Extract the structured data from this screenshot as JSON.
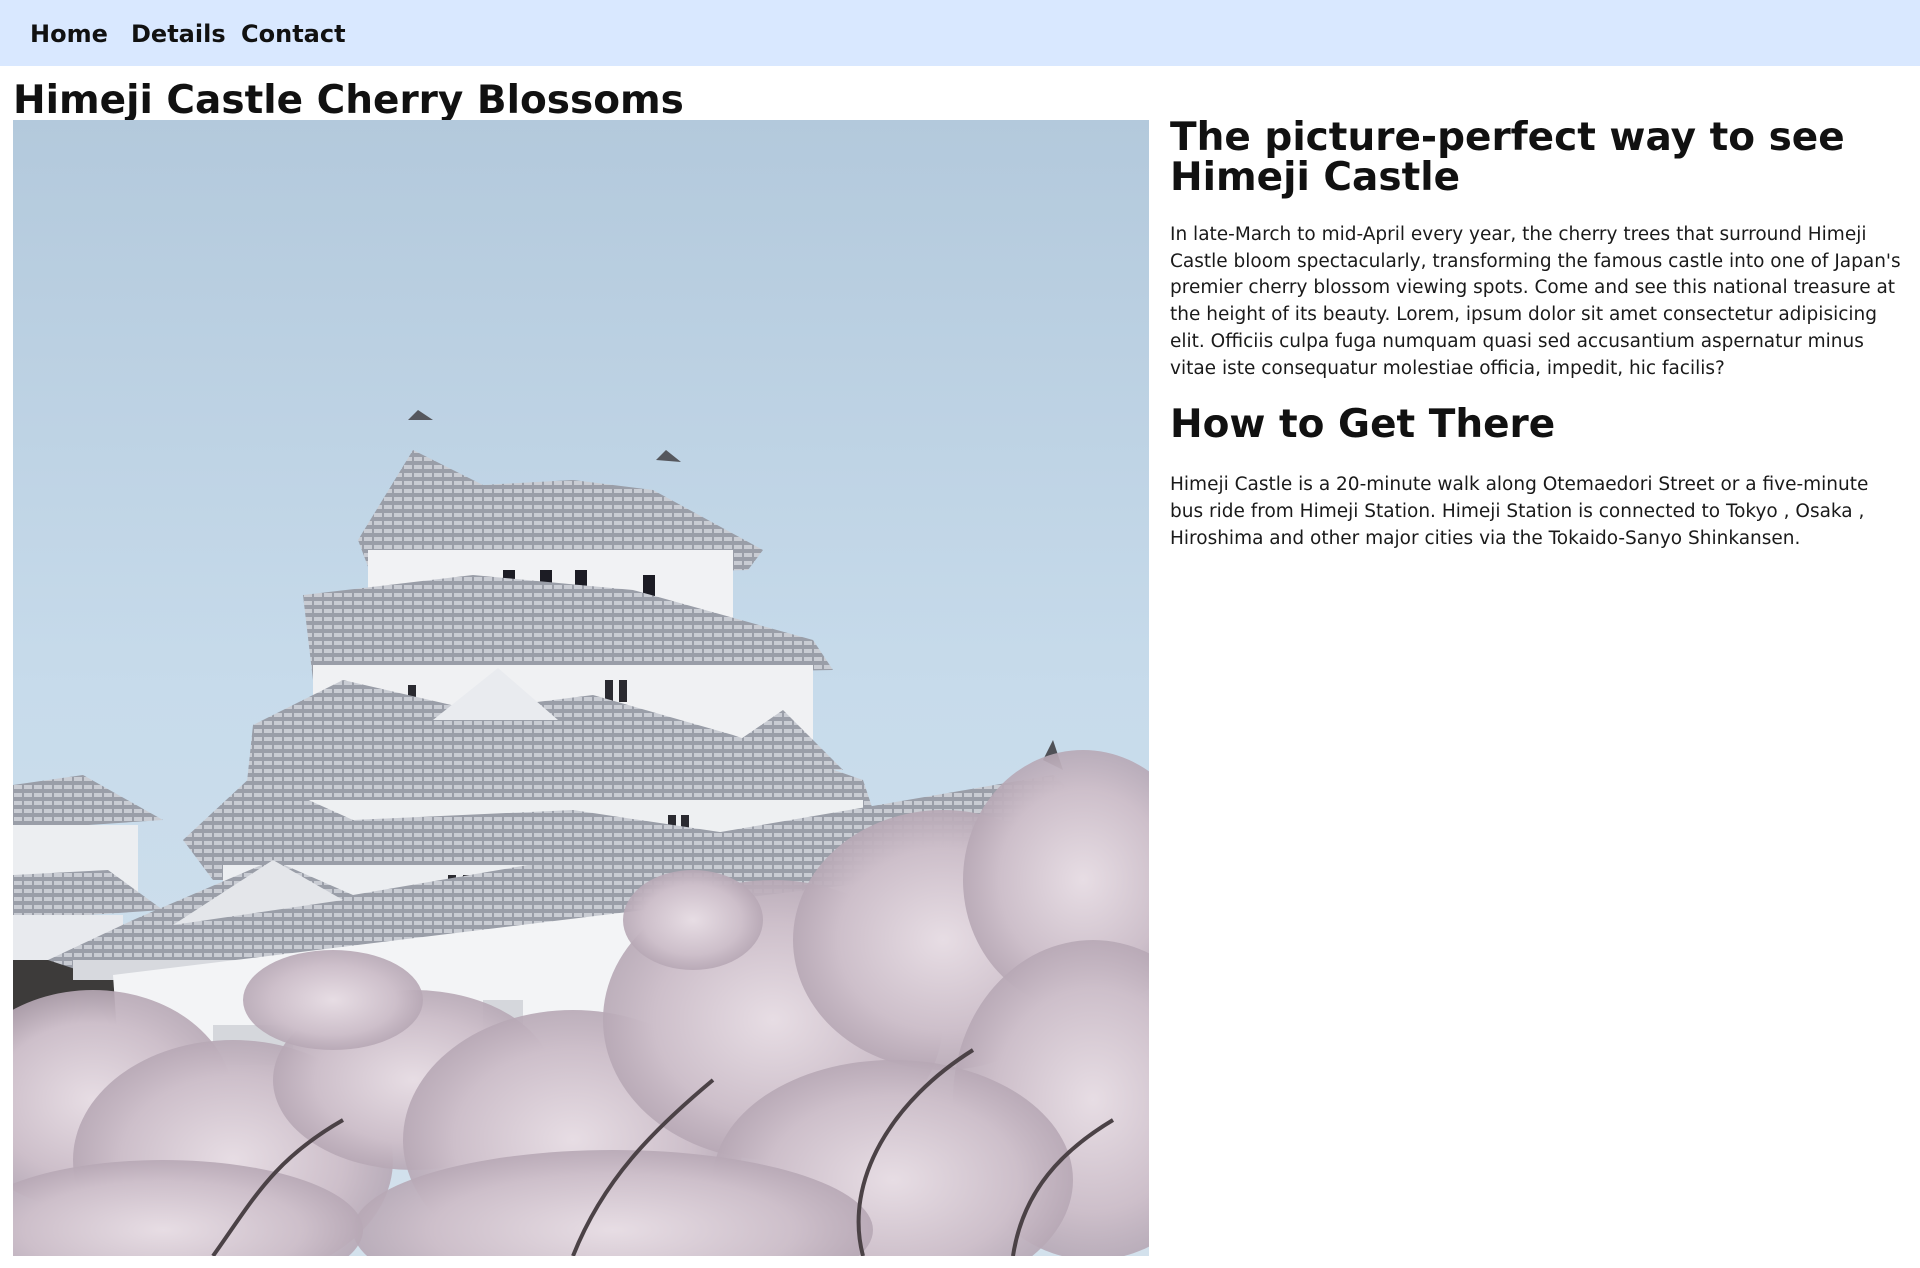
{
  "nav": {
    "items": [
      {
        "label": "Home"
      },
      {
        "label": "Details"
      },
      {
        "label": "Contact"
      }
    ]
  },
  "page": {
    "title": "Himeji Castle Cherry Blossoms"
  },
  "hero_image": {
    "subject": "Himeji Castle with cherry blossoms in bloom"
  },
  "article": {
    "heading": "The picture-perfect way to see Himeji Castle",
    "intro": "In late-March to mid-April every year, the cherry trees that surround Himeji Castle bloom spectacularly, transforming the famous castle into one of Japan's premier cherry blossom viewing spots. Come and see this national treasure at the height of its beauty. Lorem, ipsum dolor sit amet consectetur adipisicing elit. Officiis culpa fuga numquam quasi sed accusantium aspernatur minus vitae iste consequatur molestiae officia, impedit, hic facilis?",
    "directions_heading": "How to Get There",
    "directions": "Himeji Castle is a 20-minute walk along Otemaedori Street or a five-minute bus ride from Himeji Station. Himeji Station is connected to Tokyo , Osaka , Hiroshima and other major cities via the Tokaido-Sanyo Shinkansen."
  },
  "colors": {
    "nav_background": "#d9e8ff",
    "sky": "#bcd3e6",
    "castle_wall": "#f2f3f5",
    "roof": "#8b8f99",
    "blossom": "#d9cdd6"
  }
}
